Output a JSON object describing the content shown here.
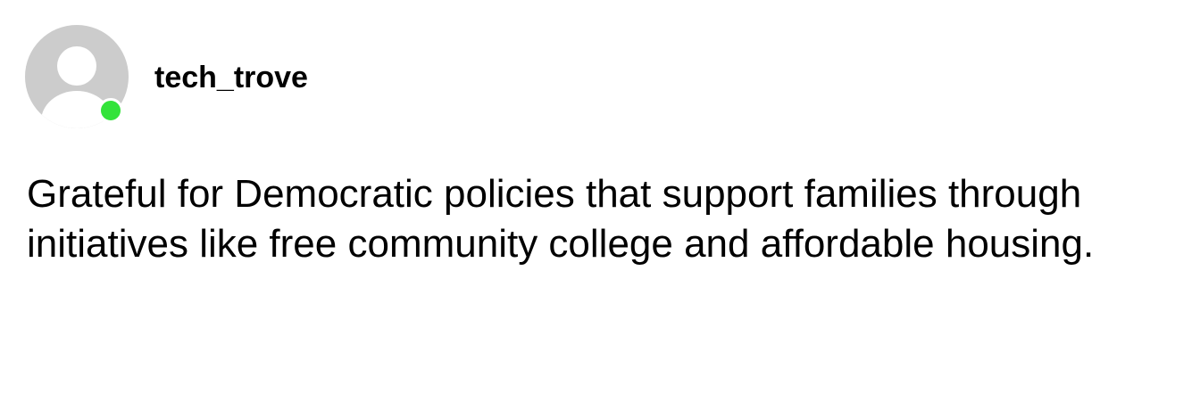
{
  "post": {
    "author": {
      "username": "tech_trove",
      "avatar_icon": "default-user-avatar-icon",
      "status": "online",
      "status_color": "#33e33a"
    },
    "body": "Grateful for Democratic policies that support families through initiatives like free community college and affordable housing."
  }
}
